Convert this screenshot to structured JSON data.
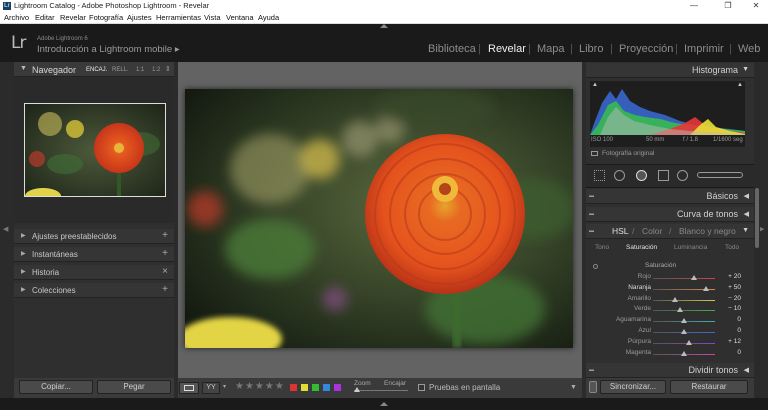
{
  "window": {
    "title": "Lightroom Catalog - Adobe Photoshop Lightroom - Revelar",
    "app_icon": "Lr"
  },
  "menu": [
    "Archivo",
    "Editar",
    "Revelar",
    "Fotografía",
    "Ajustes",
    "Herramientas",
    "Vista",
    "Ventana",
    "Ayuda"
  ],
  "identity": {
    "logo": "Lr",
    "product": "Adobe Lightroom 6",
    "subtitle": "Introducción a Lightroom mobile ▸"
  },
  "modules": [
    "Biblioteca",
    "Revelar",
    "Mapa",
    "Libro",
    "Proyección",
    "Imprimir",
    "Web"
  ],
  "active_module": "Revelar",
  "navigator": {
    "title": "Navegador",
    "zoom_options": [
      "ENCAJ.",
      "RELL.",
      "1:1",
      "1:2"
    ]
  },
  "left_panels": [
    {
      "label": "Ajustes preestablecidos",
      "end": "+"
    },
    {
      "label": "Instantáneas",
      "end": "+"
    },
    {
      "label": "Historia",
      "end": "×"
    },
    {
      "label": "Colecciones",
      "end": "+"
    }
  ],
  "left_buttons": {
    "copy": "Copiar...",
    "paste": "Pegar"
  },
  "histogram": {
    "title": "Histograma",
    "iso": "ISO 100",
    "focal": "50 mm",
    "aperture": "f / 1.8",
    "shutter": "1/1600 seg",
    "original_label": "Fotografía original"
  },
  "right_panels": {
    "basic": "Básicos",
    "tone_curve": "Curva de tonos",
    "hsl_tabs": [
      "HSL",
      "Color",
      "Blanco y negro"
    ],
    "hsl_subtabs": [
      "Tono",
      "Saturación",
      "Luminancia",
      "Todo"
    ],
    "hsl_section": "Saturación",
    "split_toning": "Dividir tonos"
  },
  "saturation_sliders": [
    {
      "name": "Rojo",
      "value": "+ 20",
      "level": 0.66,
      "color": "#c44"
    },
    {
      "name": "Naranja",
      "value": "+ 50",
      "level": 0.85,
      "color": "#d84"
    },
    {
      "name": "Amarillo",
      "value": "− 20",
      "level": 0.36,
      "color": "#cc4"
    },
    {
      "name": "Verde",
      "value": "− 10",
      "level": 0.43,
      "color": "#4a4"
    },
    {
      "name": "Aguamarina",
      "value": "0",
      "level": 0.5,
      "color": "#4aa"
    },
    {
      "name": "Azul",
      "value": "0",
      "level": 0.5,
      "color": "#46c"
    },
    {
      "name": "Púrpura",
      "value": "+ 12",
      "level": 0.58,
      "color": "#84c"
    },
    {
      "name": "Magenta",
      "value": "0",
      "level": 0.5,
      "color": "#c4a"
    }
  ],
  "right_buttons": {
    "sync": "Sincronizar...",
    "reset": "Restaurar"
  },
  "toolbar": {
    "zoom_label": "Zoom",
    "zoom_value": "Encajar",
    "proof_label": "Pruebas en pantalla",
    "stars": "★★★★★",
    "color_labels": [
      "#d33",
      "#dd3",
      "#3b3",
      "#38d",
      "#a3d"
    ]
  }
}
